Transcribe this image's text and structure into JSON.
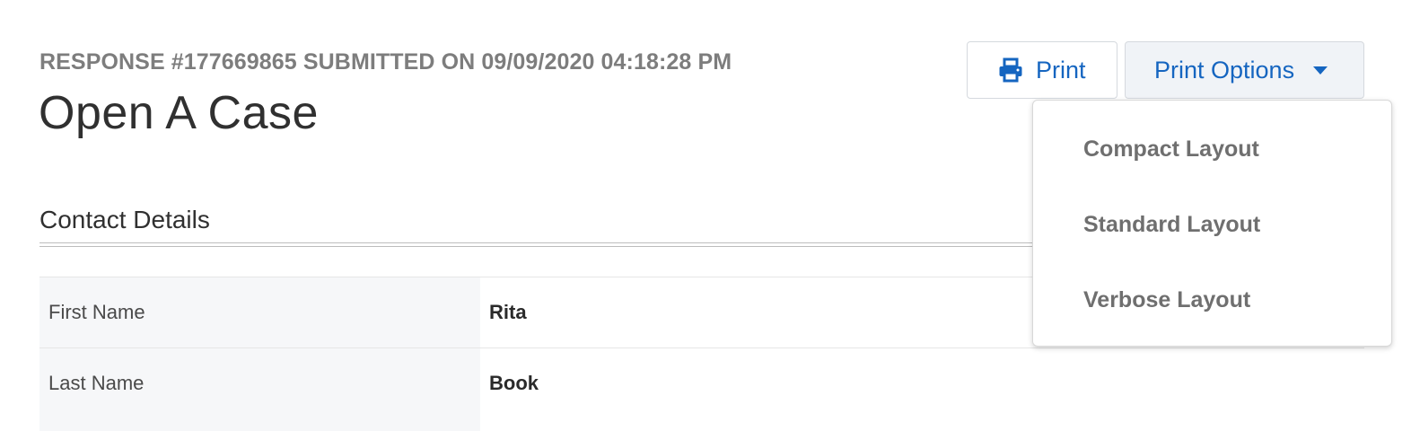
{
  "header": {
    "response_meta": "RESPONSE #177669865 SUBMITTED ON 09/09/2020 04:18:28 PM",
    "title": "Open A Case"
  },
  "toolbar": {
    "print_label": "Print",
    "print_icon": "printer-icon",
    "print_options_label": "Print Options",
    "print_options_icon": "caret-down-icon",
    "accent_color": "#1565c0"
  },
  "section": {
    "title": "Contact Details"
  },
  "fields": [
    {
      "label": "First Name",
      "value": "Rita"
    },
    {
      "label": "Last Name",
      "value": "Book"
    }
  ],
  "print_options_menu": {
    "items": [
      {
        "label": "Compact Layout"
      },
      {
        "label": "Standard Layout"
      },
      {
        "label": "Verbose Layout"
      }
    ]
  }
}
